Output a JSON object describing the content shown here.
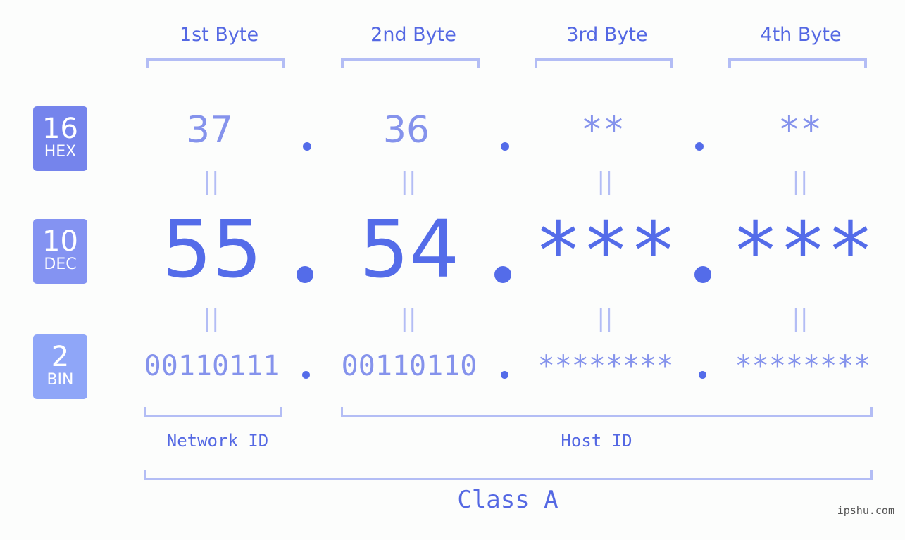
{
  "bases": [
    {
      "num": "16",
      "label": "HEX",
      "color": "#7584ec"
    },
    {
      "num": "10",
      "label": "DEC",
      "color": "#8493f2"
    },
    {
      "num": "2",
      "label": "BIN",
      "color": "#8fa6f8"
    }
  ],
  "bytes": [
    {
      "header": "1st Byte",
      "hex": "37",
      "dec": "55",
      "bin": "00110111"
    },
    {
      "header": "2nd Byte",
      "hex": "36",
      "dec": "54",
      "bin": "00110110"
    },
    {
      "header": "3rd Byte",
      "hex": "**",
      "dec": "***",
      "bin": "********"
    },
    {
      "header": "4th Byte",
      "hex": "**",
      "dec": "***",
      "bin": "********"
    }
  ],
  "equals_glyph": "||",
  "network_id_label": "Network ID",
  "host_id_label": "Host ID",
  "class_label": "Class A",
  "watermark": "ipshu.com",
  "colors": {
    "accent": "#546ce9",
    "light": "#8593ec",
    "bracket": "#b3bdf5"
  }
}
